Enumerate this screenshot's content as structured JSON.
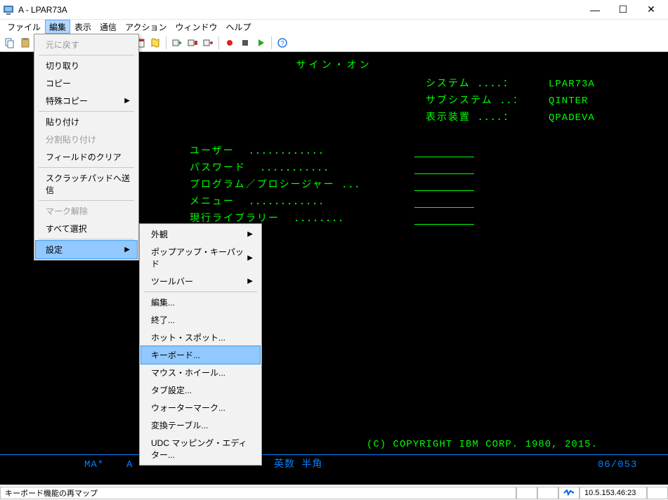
{
  "window": {
    "title": "A - LPAR73A",
    "buttons": {
      "min": "—",
      "max": "☐",
      "close": "✕"
    }
  },
  "menubar": [
    "ファイル",
    "編集",
    "表示",
    "通信",
    "アクション",
    "ウィンドウ",
    "ヘルプ"
  ],
  "menubar_active_index": 1,
  "dropdown_main": [
    {
      "label": "元に戻す",
      "disabled": true
    },
    {
      "sep": true
    },
    {
      "label": "切り取り"
    },
    {
      "label": "コピー"
    },
    {
      "label": "特殊コピー",
      "submenu": true
    },
    {
      "sep": true
    },
    {
      "label": "貼り付け"
    },
    {
      "label": "分割貼り付け",
      "disabled": true
    },
    {
      "label": "フィールドのクリア"
    },
    {
      "sep": true
    },
    {
      "label": "スクラッチパッドへ送信"
    },
    {
      "sep": true
    },
    {
      "label": "マーク解除",
      "disabled": true
    },
    {
      "label": "すべて選択"
    },
    {
      "sep": true
    },
    {
      "label": "設定",
      "submenu": true,
      "highlight": true
    }
  ],
  "dropdown_sub": [
    {
      "label": "外観",
      "submenu": true
    },
    {
      "label": "ポップアップ・キーパッド",
      "submenu": true
    },
    {
      "label": "ツールバー",
      "submenu": true
    },
    {
      "sep": true
    },
    {
      "label": "編集..."
    },
    {
      "label": "終了..."
    },
    {
      "label": "ホット・スポット..."
    },
    {
      "label": "キーボード...",
      "highlight": true
    },
    {
      "label": "マウス・ホイール..."
    },
    {
      "label": "タブ設定..."
    },
    {
      "label": "ウォーターマーク..."
    },
    {
      "label": "変換テーブル..."
    },
    {
      "label": "UDC マッピング・エディター..."
    }
  ],
  "terminal": {
    "title": "サイン・オン",
    "info": [
      {
        "label": "システム  ．．．．：",
        "value": "LPAR73A"
      },
      {
        "label": "サブシステム ．．：",
        "value": "QINTER"
      },
      {
        "label": "表示装置 ．．．．：",
        "value": "QPADEVA"
      }
    ],
    "fields": [
      "ユーザー  ．．．．．．．．．．．．",
      "パスワード  ．．．．．．．．．．．",
      "プログラム／プロシージャー ．．．",
      "メニュー  ．．．．．．．．．．．．",
      "現行ライブラリー  ．．．．．．．．"
    ],
    "copyright": "(C) COPYRIGHT IBM CORP. 1980, 2015.",
    "ma": "MA*",
    "a": "A",
    "eisu": "英数 半角",
    "pos": "06/053"
  },
  "status": {
    "text": "キーボード機能の再マップ",
    "right": "10.5.153.46:23"
  },
  "icons": {
    "toolbar_names": [
      "copy-icon",
      "paste-icon",
      "sep",
      "send-icon",
      "receive-icon",
      "screen-icon",
      "color-icon",
      "grid-icon",
      "mail-icon",
      "calendar-icon",
      "script-icon",
      "sep",
      "play-macro-icon",
      "stop-macro-icon",
      "record-macro-icon",
      "sep",
      "record-icon",
      "stop-icon",
      "play-icon",
      "sep",
      "help-icon"
    ]
  }
}
